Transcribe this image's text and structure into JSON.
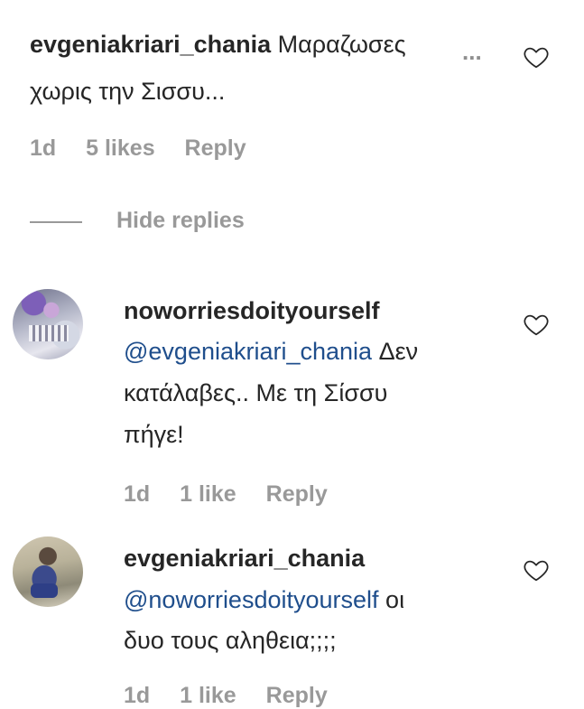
{
  "comments": [
    {
      "username": "evgeniakriari_chania",
      "text_line1": "Μαραζωσες",
      "text_line2": "χωρις την Σισσυ...",
      "more_label": "...",
      "time": "1d",
      "likes": "5 likes",
      "reply": "Reply"
    }
  ],
  "hide_replies_label": "Hide replies",
  "replies": [
    {
      "username": "noworriesdoityourself",
      "mention": "@evgeniakriari_chania",
      "text_line1": "Δεν",
      "text_line2": "κατάλαβες.. Με τη Σίσσυ",
      "text_line3": "πήγε!",
      "time": "1d",
      "likes": "1 like",
      "reply": "Reply"
    },
    {
      "username": "evgeniakriari_chania",
      "mention": "@noworriesdoityourself",
      "text_line1": "οι",
      "text_line2": "δυο τους αληθεια;;;;",
      "time": "1d",
      "likes": "1 like",
      "reply": "Reply"
    }
  ],
  "colors": {
    "text": "#262626",
    "meta": "#999999",
    "mention": "#1f4e8c"
  }
}
